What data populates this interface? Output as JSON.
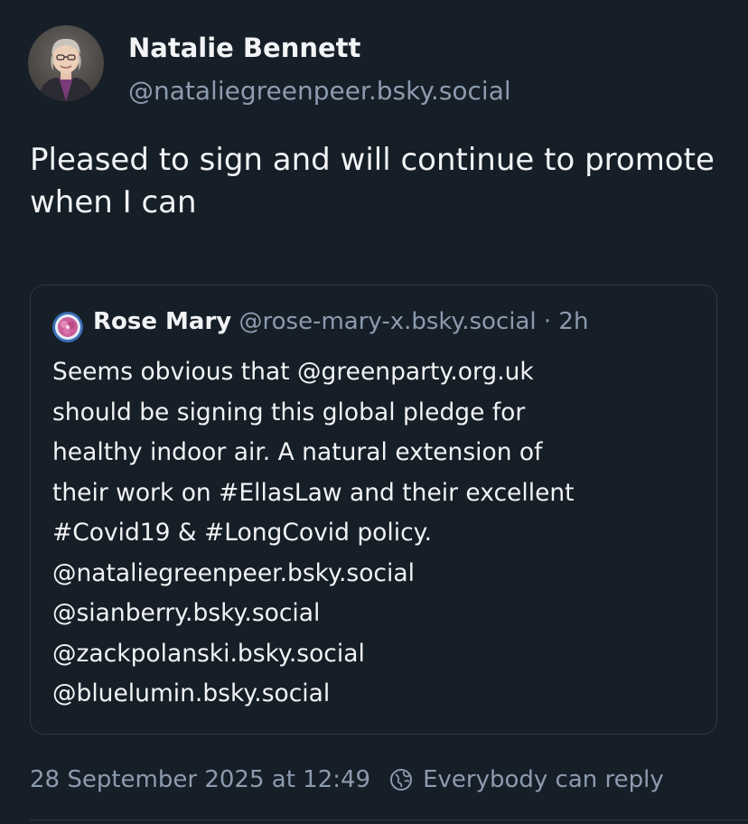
{
  "author": {
    "display_name": "Natalie Bennett",
    "handle": "@nataliegreenpeer.bsky.social"
  },
  "post": {
    "text": "Pleased to sign and will continue to promote when I can"
  },
  "quote": {
    "display_name": "Rose Mary",
    "handle": "@rose-mary-x.bsky.social",
    "separator": " · ",
    "time": "2h",
    "lines": [
      "Seems obvious that @greenparty.org.uk",
      "should be signing this global pledge for",
      "healthy indoor air. A natural extension of",
      "their work on #EllasLaw and their excellent",
      "#Covid19 & #LongCovid policy.",
      "@nataliegreenpeer.bsky.social",
      "@sianberry.bsky.social",
      "@zackpolanski.bsky.social",
      "@bluelumin.bsky.social"
    ]
  },
  "footer": {
    "timestamp": "28 September 2025 at 12:49",
    "reply_setting": "Everybody can reply",
    "reply_icon": "globe-reply-icon"
  },
  "colors": {
    "background": "#161e27",
    "text_primary": "#f1f3f5",
    "text_secondary": "#8c9bae",
    "border": "#2d3947"
  }
}
